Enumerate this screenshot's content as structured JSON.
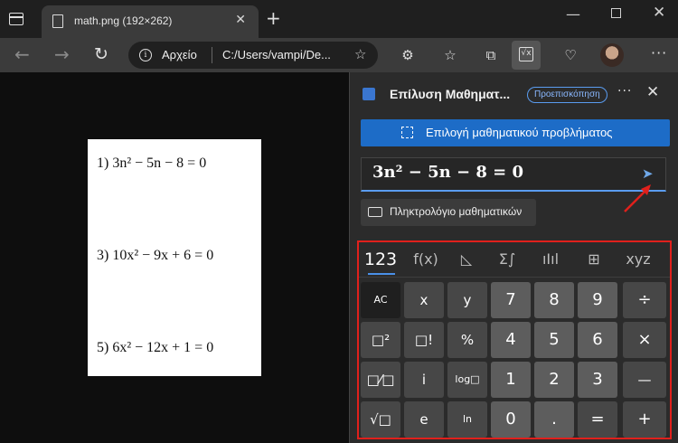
{
  "browser": {
    "tab_title": "math.png (192×262)",
    "address_label": "Αρχείο",
    "address_url": "C:/Users/vampi/De..."
  },
  "document": {
    "equations": [
      "1)  3n² − 5n − 8 = 0",
      "3)  10x² − 9x + 6 = 0",
      "5)  6x² − 12x + 1 = 0"
    ]
  },
  "sidebar": {
    "title": "Επίλυση Μαθηματ...",
    "badge": "Προεπισκόπηση",
    "select_button": "Επιλογή μαθηματικού προβλήματος",
    "input_value": "3n² − 5n − 8 = 0",
    "keyboard_button": "Πληκτρολόγιο μαθηματικών"
  },
  "keypad": {
    "tabs": [
      "123",
      "f(x)",
      "◺",
      "Σ∫",
      "ıIıl",
      "⊞",
      "xyz"
    ],
    "keys": [
      [
        "AC",
        "x",
        "y",
        "7",
        "8",
        "9",
        "÷"
      ],
      [
        "□²",
        "□!",
        "%",
        "4",
        "5",
        "6",
        "×"
      ],
      [
        "□⁄□",
        "i",
        "log□",
        "1",
        "2",
        "3",
        "—"
      ],
      [
        "√□",
        "e",
        "ln",
        "0",
        ".",
        "=",
        "+"
      ]
    ]
  },
  "colors": {
    "accent": "#1d6cc7",
    "highlight": "#e0201c"
  }
}
